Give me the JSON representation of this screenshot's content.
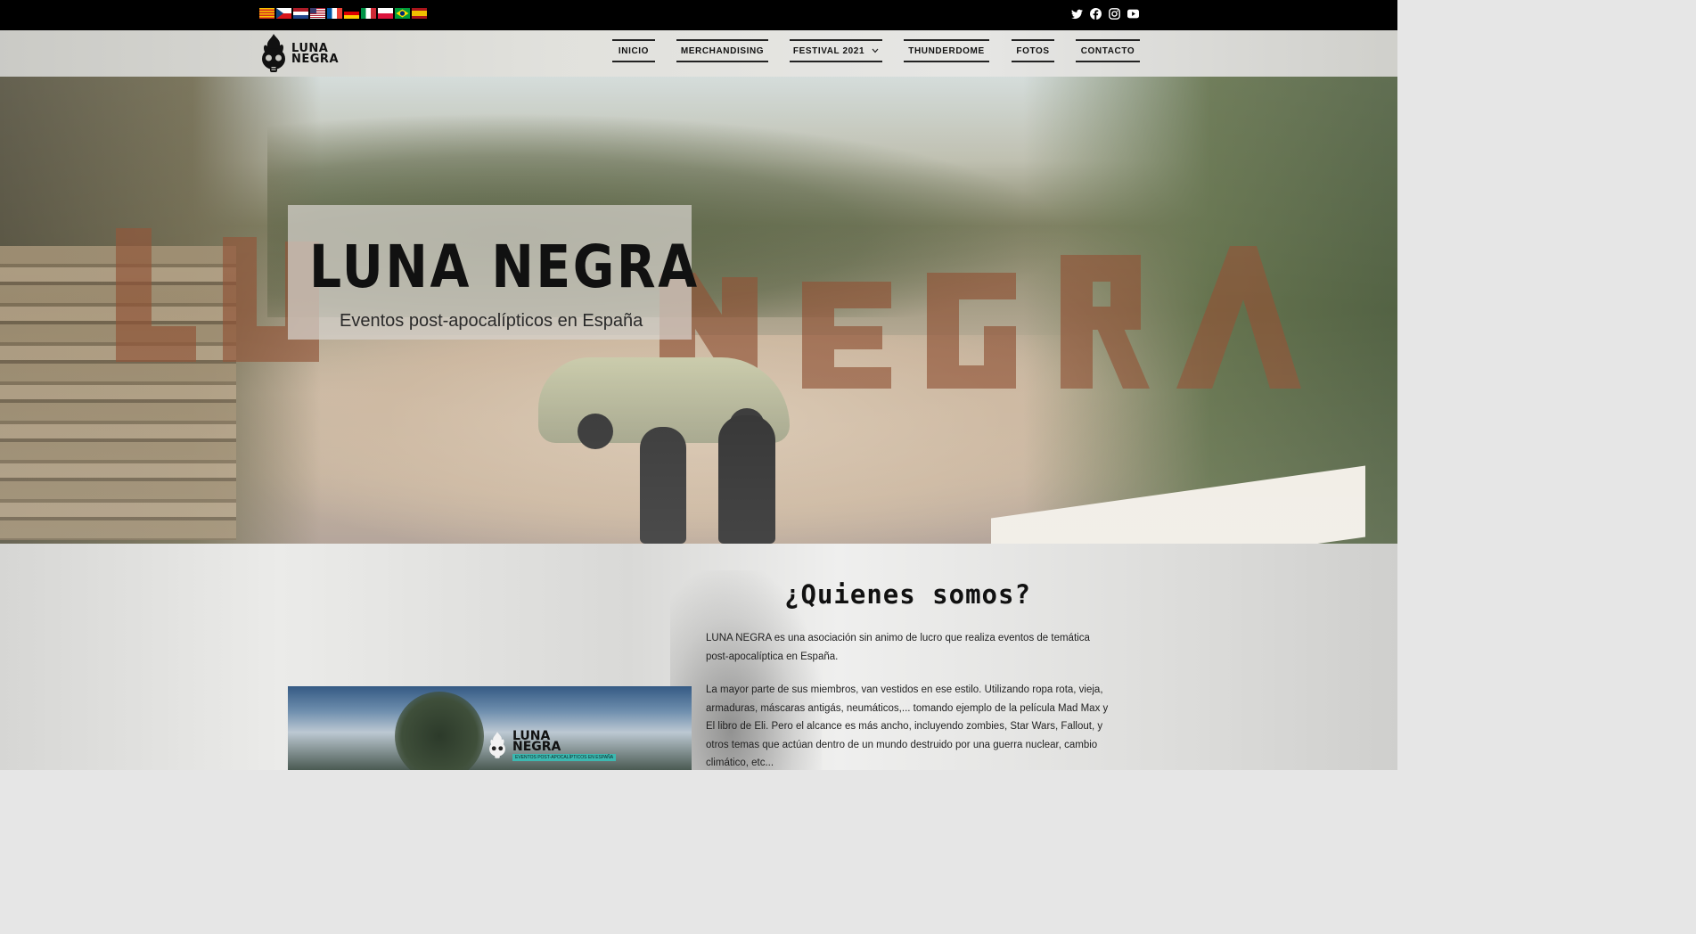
{
  "topbar": {
    "flags": [
      {
        "name": "catalan-flag-icon",
        "colors": [
          "#f6c300",
          "#d52b1e"
        ]
      },
      {
        "name": "czech-flag-icon",
        "colors": [
          "#ffffff",
          "#d7141a",
          "#11457e"
        ]
      },
      {
        "name": "dutch-flag-icon",
        "colors": [
          "#ae1c28",
          "#ffffff",
          "#21468b"
        ]
      },
      {
        "name": "usa-flag-icon",
        "colors": [
          "#b22234",
          "#ffffff",
          "#3c3b6e"
        ]
      },
      {
        "name": "french-flag-icon",
        "colors": [
          "#0055a4",
          "#ffffff",
          "#ef4135"
        ]
      },
      {
        "name": "german-flag-icon",
        "colors": [
          "#000000",
          "#dd0000",
          "#ffce00"
        ]
      },
      {
        "name": "italian-flag-icon",
        "colors": [
          "#009246",
          "#ffffff",
          "#ce2b37"
        ]
      },
      {
        "name": "polish-flag-icon",
        "colors": [
          "#ffffff",
          "#dc143c"
        ]
      },
      {
        "name": "brazil-flag-icon",
        "colors": [
          "#009c3b",
          "#ffdf00",
          "#002776"
        ]
      },
      {
        "name": "spanish-flag-icon",
        "colors": [
          "#aa151b",
          "#f1bf00"
        ]
      }
    ],
    "social": [
      "twitter-icon",
      "facebook-icon",
      "instagram-icon",
      "youtube-icon"
    ]
  },
  "header": {
    "logo_line1": "LUNA",
    "logo_line2": "NEGRA",
    "nav": [
      {
        "label": "INICIO"
      },
      {
        "label": "MERCHANDISING"
      },
      {
        "label": "FESTIVAL 2021"
      },
      {
        "label": "THUNDERDOME"
      },
      {
        "label": "FOTOS"
      },
      {
        "label": "CONTACTO"
      }
    ]
  },
  "hero": {
    "title": "LUNA NEGRA",
    "subtitle": "Eventos post-apocalípticos en España",
    "accent_color": "#8a4a2c"
  },
  "about": {
    "title": "¿Quienes somos?",
    "paragraph1": "LUNA NEGRA es una asociación sin animo de lucro que realiza eventos de temática post-apocalíptica en España.",
    "paragraph2": "La mayor parte de sus miembros, van vestidos en ese estilo. Utilizando ropa rota, vieja, armaduras, máscaras antigás, neumáticos,... tomando ejemplo de la película Mad Max y El libro de Eli. Pero el alcance es más ancho, incluyendo zombies, Star Wars, Fallout, y otros temas que actúan dentro de un mundo destruido por una guerra nuclear, cambio climático, etc...",
    "image_logo_line1": "LUNA",
    "image_logo_line2": "NEGRA",
    "image_tagline": "EVENTOS POST-APOCALÍPTICOS EN ESPAÑA"
  }
}
